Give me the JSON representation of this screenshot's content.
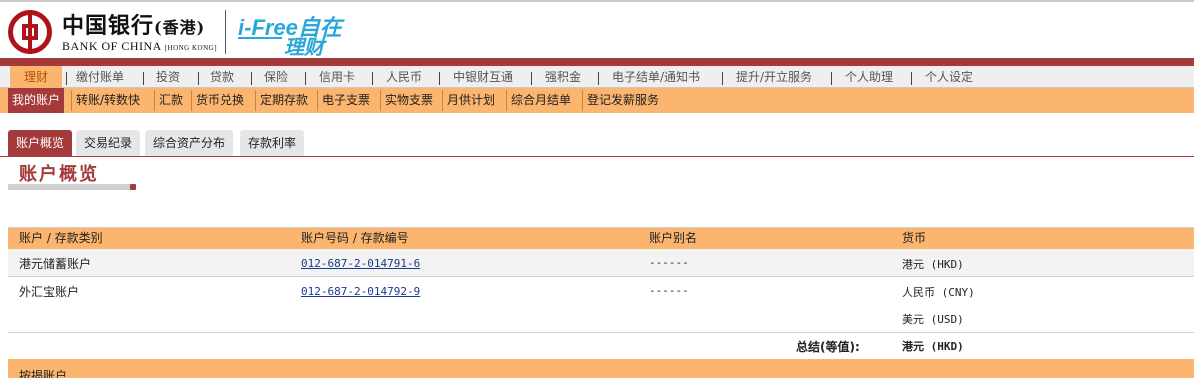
{
  "brand": {
    "bank_cn": "中国银行",
    "bank_cn_region": "(香港)",
    "bank_en": "BANK OF CHINA",
    "bank_en_region": "[HONG KONG]",
    "product_line1": "i-Free自在",
    "product_line2": "理财"
  },
  "main_nav": [
    "理财",
    "缴付账单",
    "投资",
    "贷款",
    "保险",
    "信用卡",
    "人民币",
    "中银财互通",
    "强积金",
    "电子结单/通知书",
    "提升/开立服务",
    "个人助理",
    "个人设定"
  ],
  "sub_nav": [
    "我的账户",
    "转账/转数快",
    "汇款",
    "货币兑换",
    "定期存款",
    "电子支票",
    "实物支票",
    "月供计划",
    "综合月结单",
    "登记发薪服务"
  ],
  "tabs": [
    "账户概览",
    "交易纪录",
    "综合资产分布",
    "存款利率"
  ],
  "page_title": "账户概览",
  "table": {
    "headers": [
      "账户 / 存款类别",
      "账户号码 / 存款编号",
      "账户别名",
      "货币"
    ],
    "rows": [
      {
        "type": "港元储蓄账户",
        "number": "012-687-2-014791-6",
        "alias": "------",
        "currencies": [
          "港元 (HKD)"
        ]
      },
      {
        "type": "外汇宝账户",
        "number": "012-687-2-014792-9",
        "alias": "------",
        "currencies": [
          "人民币 (CNY)",
          "美元 (USD)"
        ]
      }
    ],
    "summary_label": "总结(等值):",
    "summary_value": "港元 (HKD)"
  },
  "bottom_section_label": "按揭账户",
  "colors": {
    "accent_red": "#a43a3a",
    "accent_orange": "#fbb56f",
    "link": "#1a3a8a"
  }
}
